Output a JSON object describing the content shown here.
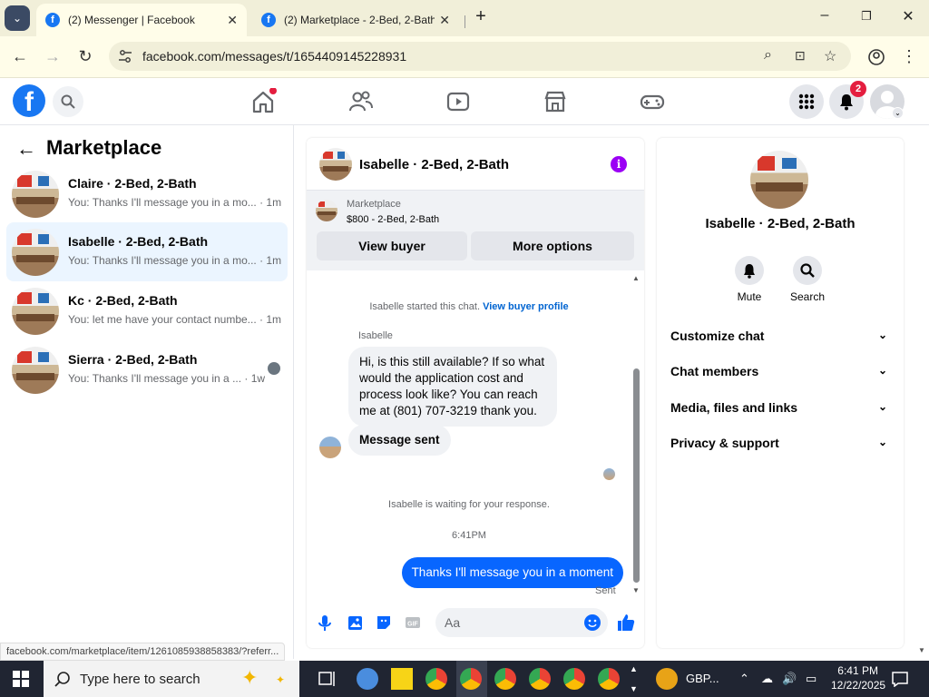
{
  "browser": {
    "tabs": [
      {
        "label": "(2) Messenger | Facebook",
        "active": true
      },
      {
        "label": "(2) Marketplace - 2-Bed, 2-Bath",
        "active": false
      }
    ],
    "url": "facebook.com/messages/t/1654409145228931",
    "status_url": "facebook.com/marketplace/item/1261085938858383/?referr..."
  },
  "header": {
    "logo": "f",
    "notifications_badge": "2"
  },
  "sidebar": {
    "title": "Marketplace",
    "conversations": [
      {
        "name": "Claire · 2-Bed, 2-Bath",
        "preview": "You: Thanks I'll message you in a mo...",
        "time": "· 1m",
        "selected": false
      },
      {
        "name": "Isabelle · 2-Bed, 2-Bath",
        "preview": "You: Thanks I'll message you in a mo...",
        "time": "· 1m",
        "selected": true
      },
      {
        "name": "Kc · 2-Bed, 2-Bath",
        "preview": "You: let me have your contact numbe...",
        "time": "· 1m",
        "selected": false
      },
      {
        "name": "Sierra · 2-Bed, 2-Bath",
        "preview": "You: Thanks I'll message you in a ...",
        "time": "· 1w",
        "selected": false
      }
    ]
  },
  "chat": {
    "title": "Isabelle · 2-Bed, 2-Bath",
    "listing_label": "Marketplace",
    "listing_price": "$800 - 2-Bed, 2-Bath",
    "view_buyer": "View buyer",
    "more_options": "More options",
    "started_text": "Isabelle started this chat.",
    "buyer_profile_link": "View buyer profile",
    "sender_name": "Isabelle",
    "incoming_message": "Hi, is this still available? If so what would the application cost and process look like? You can reach me at (801) 707-3219 thank you.",
    "message_sent": "Message sent",
    "waiting_text": "Isabelle is waiting for your response.",
    "timestamp": "6:41PM",
    "outgoing_message": "Thanks I'll message you in a moment",
    "sent_status": "Sent",
    "composer_placeholder": "Aa"
  },
  "details": {
    "name": "Isabelle · 2-Bed, 2-Bath",
    "actions": [
      {
        "label": "Mute"
      },
      {
        "label": "Search"
      }
    ],
    "sections": [
      "Customize chat",
      "Chat members",
      "Media, files and links",
      "Privacy & support"
    ]
  },
  "taskbar": {
    "search_placeholder": "Type here to search",
    "currency": "GBP...",
    "time": "6:41 PM",
    "date": "12/22/2025"
  }
}
